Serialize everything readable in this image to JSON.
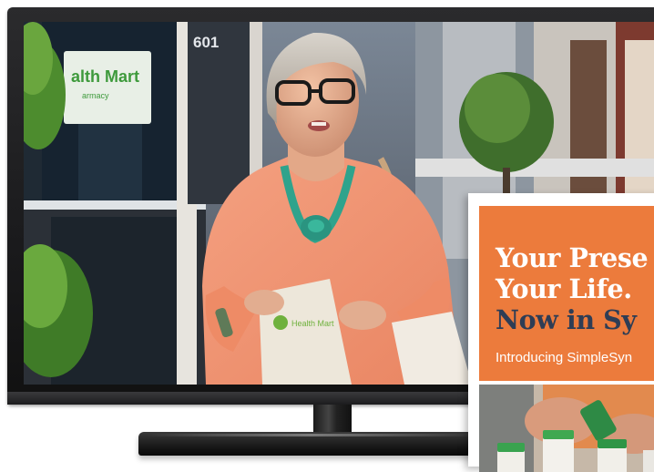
{
  "scene": {
    "screen_image": "woman with gray hair and glasses in coral blouse and teal knotted necklace holding a pharmacy bag on a storefront sidewalk",
    "storefront_sign_text": "alth Mart",
    "storefront_sign_subtext": "armacy",
    "door_number": "601",
    "bag_logo_text": "Health Mart"
  },
  "flyer": {
    "headline_line1": "Your Prese",
    "headline_line2": "Your Life.",
    "headline_line3": "Now in Sy",
    "subheadline": "Introducing SimpleSyn",
    "photo": "hands holding prescription bottles with green caps"
  },
  "colors": {
    "flyer_orange": "#ec7b3c",
    "flyer_navy": "#2e3d55",
    "blouse": "#f0906c",
    "necklace": "#2fa38c",
    "tv_bezel": "#1e1e20"
  }
}
